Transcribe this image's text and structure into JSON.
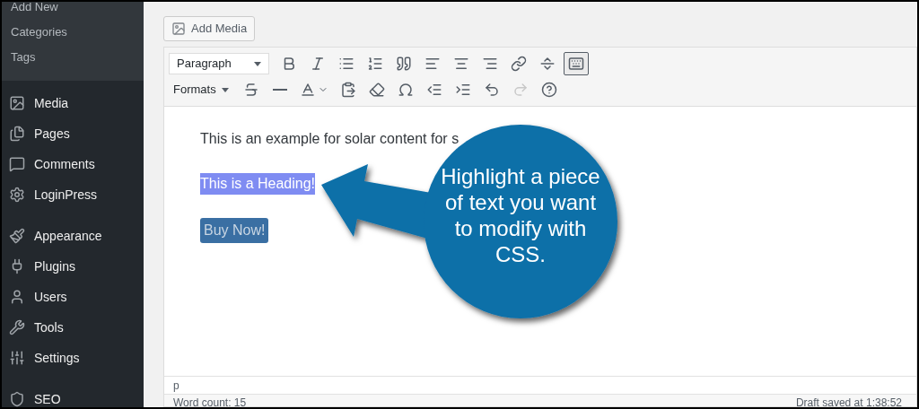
{
  "sidebar": {
    "submenu": [
      {
        "label": "Add New"
      },
      {
        "label": "Categories"
      },
      {
        "label": "Tags"
      }
    ],
    "items": [
      {
        "label": "Media",
        "kind": "media"
      },
      {
        "label": "Pages",
        "kind": "pages"
      },
      {
        "label": "Comments",
        "kind": "comments"
      },
      {
        "label": "LoginPress",
        "kind": "gear"
      },
      {
        "label": "Appearance",
        "kind": "brush"
      },
      {
        "label": "Plugins",
        "kind": "plug"
      },
      {
        "label": "Users",
        "kind": "user"
      },
      {
        "label": "Tools",
        "kind": "wrench"
      },
      {
        "label": "Settings",
        "kind": "sliders"
      },
      {
        "label": "SEO",
        "kind": "seo"
      }
    ]
  },
  "add_media": {
    "label": "Add Media"
  },
  "toolbar": {
    "block_format": "Paragraph",
    "formats_label": "Formats",
    "row_1": [
      {
        "kind": "bold",
        "pressed": false
      },
      {
        "kind": "italic",
        "pressed": false
      },
      {
        "kind": "bullets",
        "pressed": false
      },
      {
        "kind": "numbers",
        "pressed": false
      },
      {
        "kind": "quote",
        "pressed": false
      },
      {
        "kind": "alignleft",
        "pressed": false
      },
      {
        "kind": "aligncenter",
        "pressed": false
      },
      {
        "kind": "alignright",
        "pressed": false
      },
      {
        "kind": "link",
        "pressed": false
      },
      {
        "kind": "more",
        "pressed": false
      },
      {
        "kind": "toolbar",
        "pressed": true
      }
    ],
    "row_2": [
      {
        "kind": "strike",
        "disabled": false
      },
      {
        "kind": "hr",
        "disabled": false
      },
      {
        "kind": "color",
        "disabled": false
      },
      {
        "kind": "paste",
        "disabled": false
      },
      {
        "kind": "eraser",
        "disabled": false
      },
      {
        "kind": "omega",
        "disabled": false
      },
      {
        "kind": "outdent",
        "disabled": false
      },
      {
        "kind": "indent",
        "disabled": false
      },
      {
        "kind": "undo",
        "disabled": false
      },
      {
        "kind": "redo",
        "disabled": true
      },
      {
        "kind": "help",
        "disabled": false
      }
    ]
  },
  "content": {
    "paragraph": "This is an example for solar content for s",
    "heading": "This is a Heading!",
    "heading_selected": true,
    "button_label": "Buy Now!"
  },
  "path": "p",
  "status_bar": {
    "word_count": "Word count: 15",
    "draft_saved": "Draft saved at 1:38:52"
  },
  "callout": {
    "text": "Highlight a piece of text you want to modify with CSS."
  }
}
